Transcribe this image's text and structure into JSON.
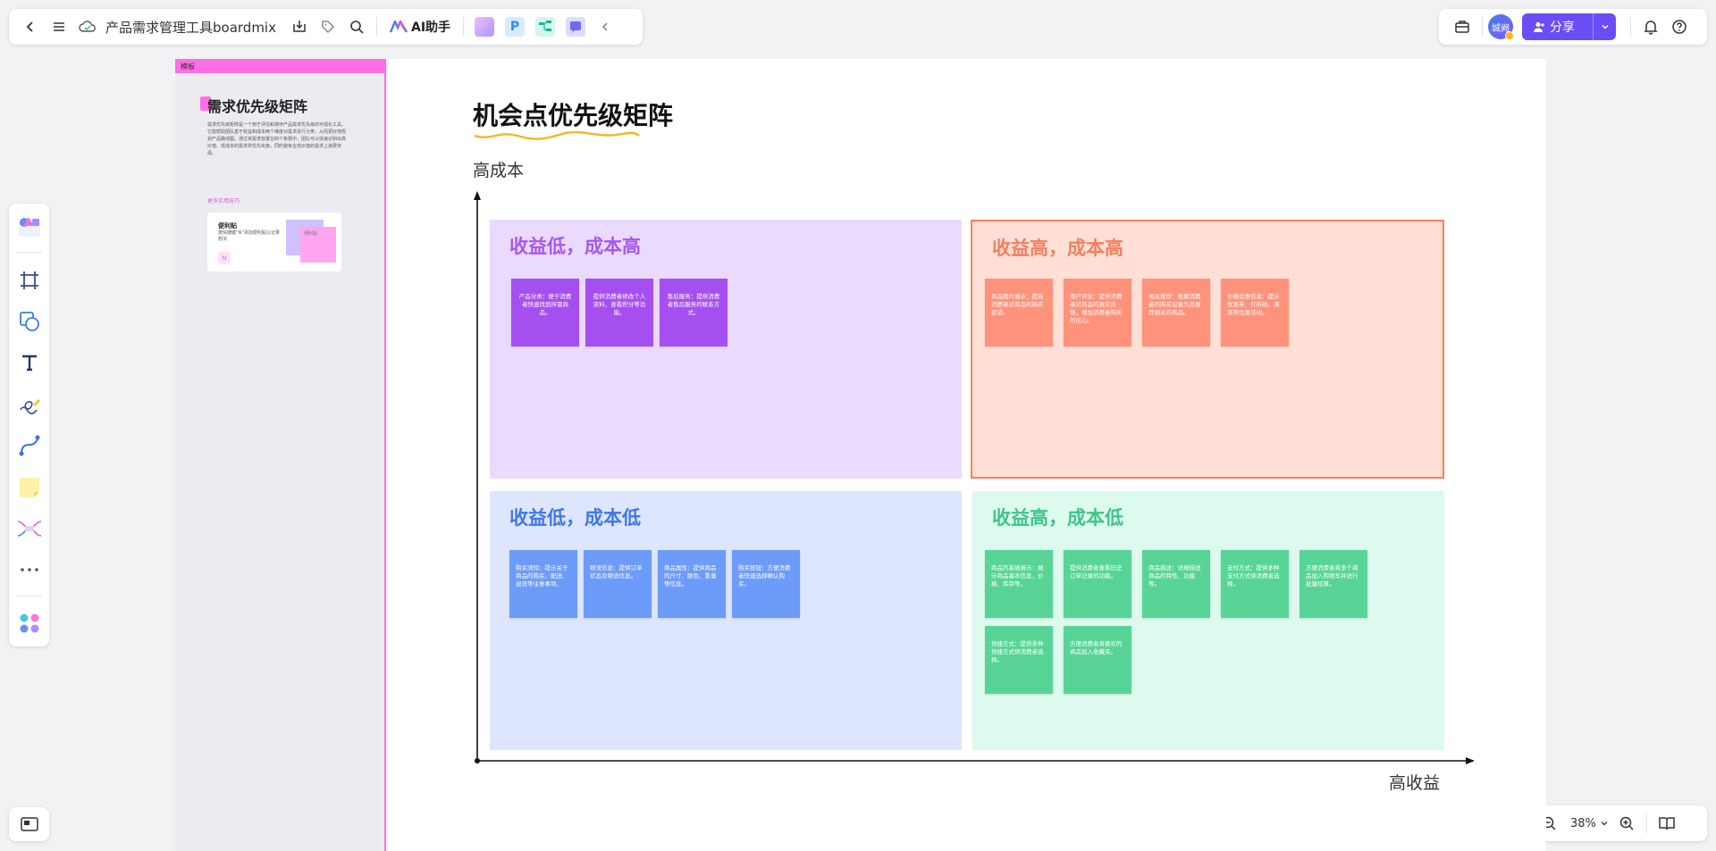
{
  "toolbar": {
    "doc_title": "产品需求管理工具boardmix",
    "ai_label": "AI助手"
  },
  "header_right": {
    "avatar_text": "城阙",
    "share_label": "分享"
  },
  "zoom": {
    "value": "38%"
  },
  "template_panel": {
    "header": "模板",
    "title": "需求优先级矩阵",
    "description": "需求优先级矩阵是一个用于评估和排序产品需求优先级的可视化工具。它能帮助团队基于收益和成本两个维度对需求进行分类，从而更好地规划产品路线图。通过将需求放置在四个象限中，团队可以快速识别出高价值、低成本的需求并优先实施，同时避免在低价值的需求上浪费资源。",
    "more_tips": "更多实用技巧",
    "card_title": "便利贴",
    "card_text": "按快捷键“N”添加便利贴以记录想法",
    "card_sticky_text": "便利贴",
    "card_badge": "N"
  },
  "board": {
    "title": "机会点优先级矩阵",
    "y_axis_label": "高成本",
    "x_axis_label": "高收益",
    "quadrants": [
      {
        "title": "收益低，成本高",
        "stickies": [
          "产品分类：便于消费者快速找到所需商品。",
          "提供消费者修改个人资料、查看积分等功能。",
          "售后服务：提供消费者售后服务的联系方式。"
        ]
      },
      {
        "title": "收益高，成本高",
        "stickies": [
          "商品图片展示：提高消费者对商品的购买欲望。",
          "用户评论：提供消费者对商品的真实反馈，增加消费者购买的信心。",
          "相关推荐：根据消费者的购买记录为其推荐相关的商品。",
          "价格优惠信息：提示优惠券、打折码、满减等优惠活动。"
        ]
      },
      {
        "title": "收益低，成本低",
        "stickies": [
          "购买须知：提示关于商品的购买、配送、退货等注意事项。",
          "物流信息：提供订单状态及物流信息。",
          "商品属性：提供商品的尺寸、颜色、重量等信息。",
          "购买按钮：方便消费者快速选择确认购买。"
        ]
      },
      {
        "title": "收益高，成本低",
        "stickies": [
          "商品的基础展示：展示商品基本信息、价格、库存等。",
          "提供消费者查看历史订单记录的功能。",
          "商品描述：详细描述商品的特性、功能等。",
          "支付方式：提供多种支付方式供消费者选择。",
          "方便消费者将多个商品加入购物车并进行批量结算。",
          "快捷方式：提供多种快捷方式供消费者选择。",
          "方便消费者将喜欢的商品加入收藏夹。"
        ]
      }
    ]
  },
  "colors": {
    "accent": "#6b4df6",
    "template_pink": "#ff6ee6",
    "purple_sticky": "#a64ff1",
    "coral_sticky": "#ff927b",
    "blue_sticky": "#6c9bfa",
    "green_sticky": "#58d596"
  }
}
